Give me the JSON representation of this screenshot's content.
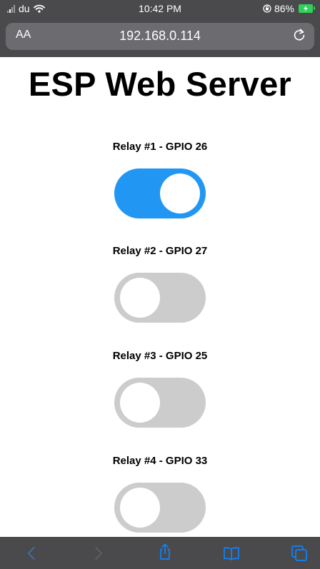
{
  "status_bar": {
    "carrier": "du",
    "time": "10:42 PM",
    "battery_percent": "86%",
    "battery_color": "#30d158"
  },
  "address_bar": {
    "text_size_label": "AA",
    "url": "192.168.0.114",
    "reload_icon": "reload-icon"
  },
  "page": {
    "title": "ESP Web Server",
    "relays": [
      {
        "label": "Relay #1 - GPIO 26",
        "on": true
      },
      {
        "label": "Relay #2 - GPIO 27",
        "on": false
      },
      {
        "label": "Relay #3 - GPIO 25",
        "on": false
      },
      {
        "label": "Relay #4 - GPIO 33",
        "on": false
      }
    ],
    "switch_on_color": "#2196f3",
    "switch_off_color": "#cccccc"
  },
  "toolbar": {
    "items": [
      "back-icon",
      "forward-icon",
      "share-icon",
      "bookmarks-icon",
      "tabs-icon"
    ]
  }
}
